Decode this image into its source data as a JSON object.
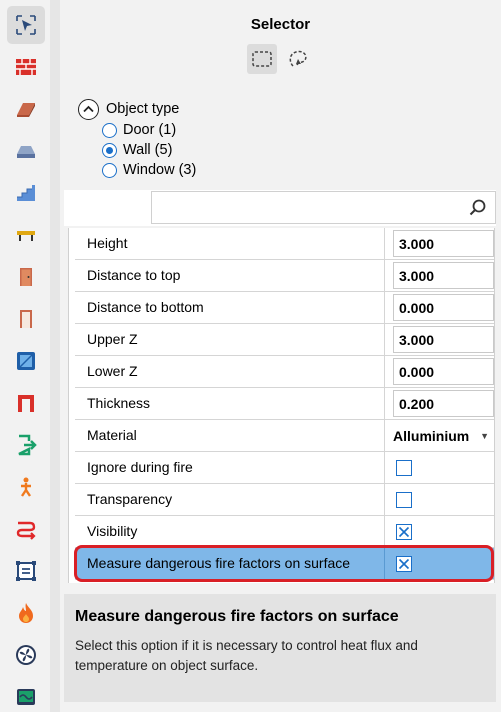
{
  "panel": {
    "title": "Selector"
  },
  "selection_modes": [
    "rectangle-select-icon",
    "lasso-select-icon"
  ],
  "toolbar": {
    "tools": [
      "selector-icon",
      "brick-wall-icon",
      "slab-icon",
      "obstacle-icon",
      "stairs-icon",
      "bench-icon",
      "door-icon",
      "open-door-icon",
      "window-icon",
      "opening-icon",
      "exit-icon",
      "person-icon",
      "route-icon",
      "area-icon",
      "fire-icon",
      "fan-icon",
      "monitor-icon"
    ]
  },
  "object_type": {
    "label": "Object type",
    "options": [
      {
        "label": "Door (1)",
        "selected": false
      },
      {
        "label": "Wall (5)",
        "selected": true
      },
      {
        "label": "Window (3)",
        "selected": false
      }
    ]
  },
  "search": {
    "placeholder": ""
  },
  "properties": [
    {
      "name": "Height",
      "value": "3.000"
    },
    {
      "name": "Distance to top",
      "value": "3.000"
    },
    {
      "name": "Distance to bottom",
      "value": "0.000"
    },
    {
      "name": "Upper Z",
      "value": "3.000"
    },
    {
      "name": "Lower Z",
      "value": "0.000"
    },
    {
      "name": "Thickness",
      "value": "0.200"
    },
    {
      "name": "Material",
      "value": "Alluminium"
    },
    {
      "name": "Ignore during fire",
      "checked": false
    },
    {
      "name": "Transparency",
      "checked": false
    },
    {
      "name": "Visibility",
      "checked": true
    },
    {
      "name": "Measure dangerous fire factors on surface",
      "checked": true
    }
  ],
  "description": {
    "title": "Measure dangerous fire factors on surface",
    "text": "Select this option if it is necessary to control heat flux and temperature on object surface."
  },
  "colors": {
    "accent": "#1a6fc9",
    "selected_row": "#7fb7e8",
    "highlight": "#d91f26"
  }
}
